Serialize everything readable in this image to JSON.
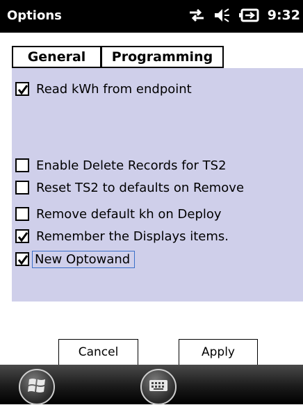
{
  "status_bar": {
    "title": "Options",
    "time": "9:32",
    "icons": [
      "connectivity-icon",
      "speaker-icon",
      "battery-icon"
    ]
  },
  "tabs": [
    {
      "label": "General",
      "selected": false
    },
    {
      "label": "Programming",
      "selected": true
    }
  ],
  "options": [
    {
      "label": "Read kWh from endpoint",
      "checked": true
    },
    {
      "label": "Enable Delete Records for TS2",
      "checked": false
    },
    {
      "label": "Reset TS2 to defaults on Remove",
      "checked": false
    },
    {
      "label": "Remove default kh on Deploy",
      "checked": false
    },
    {
      "label": "Remember the Displays items.",
      "checked": true
    },
    {
      "label": "New Optowand",
      "checked": true,
      "focused": true
    }
  ],
  "buttons": {
    "cancel": "Cancel",
    "apply": "Apply"
  },
  "taskbar": {
    "icons": [
      "windows-start-icon",
      "keyboard-icon"
    ]
  },
  "colors": {
    "panel_background": "#cfcfea",
    "title_bar": "#000000",
    "focus_border": "#3a6fc9"
  }
}
